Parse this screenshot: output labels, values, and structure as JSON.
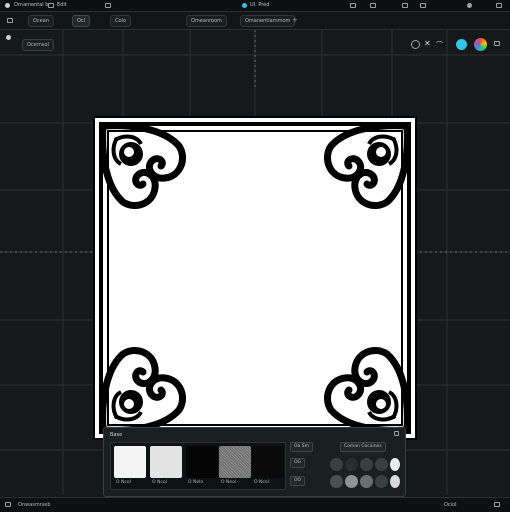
{
  "app": {
    "menu_left": "Ornamental b",
    "menu_edit": "Edit",
    "center_title": "UI. Pred",
    "accent_color": "#35c3e6"
  },
  "tabs": [
    {
      "label": "Ocean"
    },
    {
      "label": "Ocl"
    },
    {
      "label": "Colo"
    },
    {
      "label": "Omeanroom"
    },
    {
      "label": "Omanentiammom"
    }
  ],
  "toolbar": {
    "workspace_label": "Ocernsol"
  },
  "panel": {
    "title": "Base",
    "thumbnails": [
      {
        "label": "O Ncol",
        "fill": "#f4f4f4"
      },
      {
        "label": "O Ncol",
        "fill": "#e3e3e3"
      },
      {
        "label": "O Nelo",
        "fill": "#050505"
      },
      {
        "label": "O Neol",
        "fill": "#7a7a7a"
      },
      {
        "label": "O Ncol",
        "fill": "#0a0a0a"
      }
    ],
    "right_button_top": "Oa Sm",
    "right_button_wide": "Coman Cocaines",
    "right_button_mid": "OG",
    "right_button_low": "OO",
    "swatches": [
      "#3a3f3f",
      "#2a2e2e",
      "#3a3f3f",
      "#3a3f3f",
      "#ededed",
      "#4a4f4f",
      "#8e9494",
      "#6a7070",
      "#3a3f3f",
      "#d9d9d9"
    ]
  },
  "status": {
    "left": "Onwasmnieb",
    "right": "Ociol"
  }
}
